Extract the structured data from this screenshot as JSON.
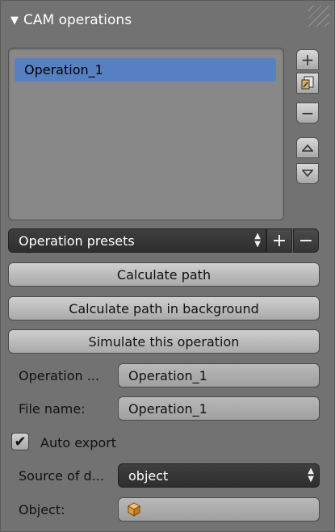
{
  "panel": {
    "title": "CAM operations",
    "collapse_glyph": "▼"
  },
  "operations_list": {
    "items": [
      {
        "label": "Operation_1",
        "selected": true
      }
    ],
    "add_glyph": "+",
    "resize_glyph": "="
  },
  "side_buttons": {
    "add_label": "+",
    "copy_icon": "copy-icon",
    "remove_label": "−",
    "up_label": "▲",
    "down_label": "▼"
  },
  "presets": {
    "label": "Operation presets",
    "add_label": "+",
    "remove_label": "−"
  },
  "buttons": {
    "calculate": "Calculate path",
    "calculate_bg": "Calculate path in background",
    "simulate": "Simulate this operation"
  },
  "fields": {
    "operation_name_label": "Operation ...",
    "operation_name_value": "Operation_1",
    "file_name_label": "File name:",
    "file_name_value": "Operation_1",
    "auto_export_label": "Auto export",
    "auto_export_checked": true,
    "source_label": "Source of d...",
    "source_value": "object",
    "object_label": "Object:"
  },
  "colors": {
    "panel_bg": "#727272",
    "selection": "#5680c2",
    "dark_widget": "#343434"
  }
}
